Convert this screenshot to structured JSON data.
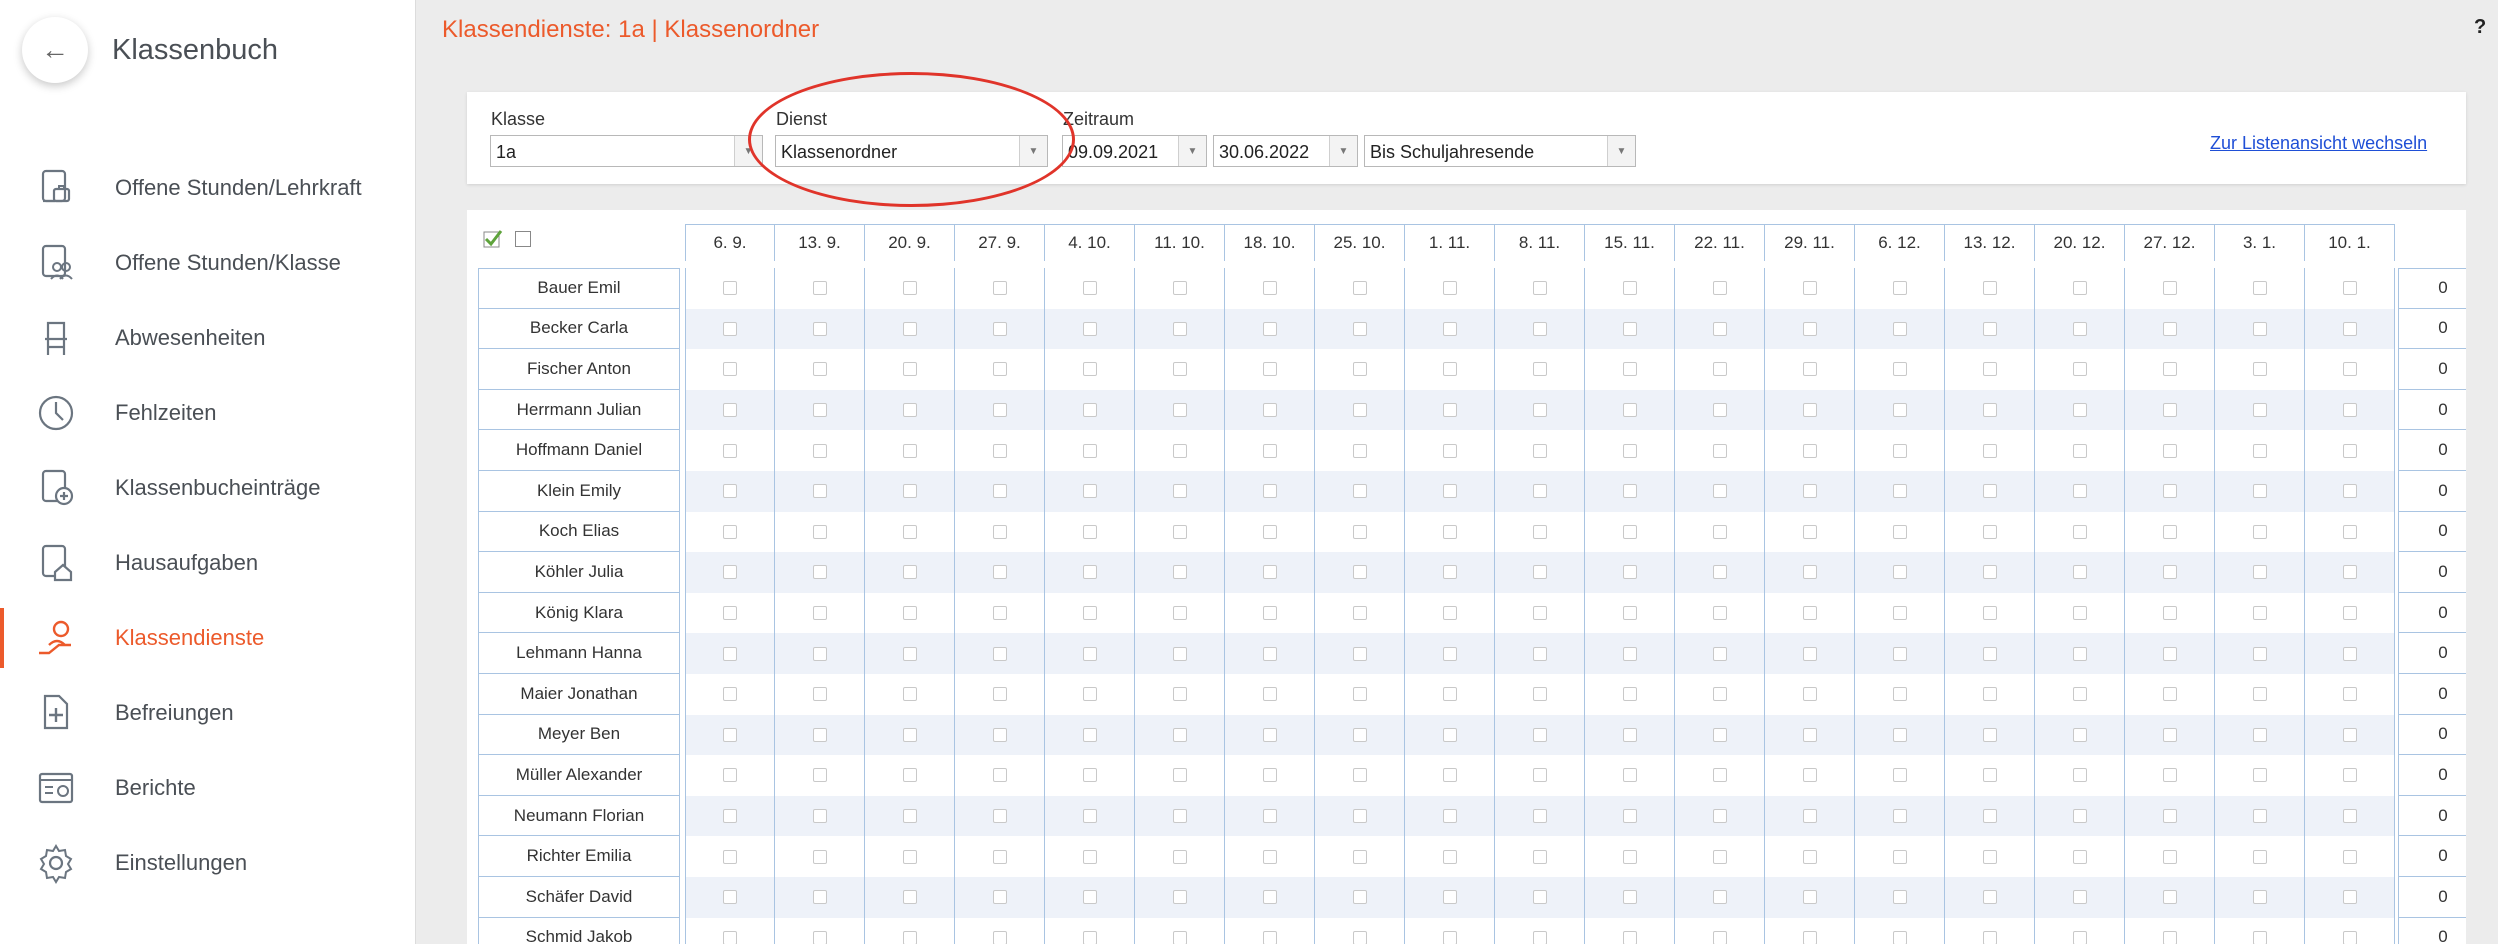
{
  "sidebar": {
    "back_icon": "arrow-left-icon",
    "title": "Klassenbuch",
    "items": [
      {
        "label": "Offene Stunden/Lehrkraft",
        "icon": "lesson-teacher-icon"
      },
      {
        "label": "Offene Stunden/Klasse",
        "icon": "lesson-class-icon"
      },
      {
        "label": "Abwesenheiten",
        "icon": "chair-icon"
      },
      {
        "label": "Fehlzeiten",
        "icon": "clock-icon"
      },
      {
        "label": "Klassenbucheinträge",
        "icon": "document-plus-icon"
      },
      {
        "label": "Hausaufgaben",
        "icon": "homework-icon"
      },
      {
        "label": "Klassendienste",
        "icon": "person-service-icon",
        "active": true
      },
      {
        "label": "Befreiungen",
        "icon": "document-cross-icon"
      },
      {
        "label": "Berichte",
        "icon": "report-icon"
      },
      {
        "label": "Einstellungen",
        "icon": "gear-icon"
      }
    ]
  },
  "header": {
    "title": "Klassendienste: 1a | Klassenordner",
    "help": "?"
  },
  "filters": {
    "klasse_label": "Klasse",
    "klasse_value": "1a",
    "dienst_label": "Dienst",
    "dienst_value": "Klassenordner",
    "zeitraum_label": "Zeitraum",
    "start_date": "09.09.2021",
    "end_date": "30.06.2022",
    "range_value": "Bis Schuljahresende",
    "list_view_link": "Zur Listenansicht wechseln"
  },
  "grid": {
    "dates": [
      "6. 9.",
      "13. 9.",
      "20. 9.",
      "27. 9.",
      "4. 10.",
      "11. 10.",
      "18. 10.",
      "25. 10.",
      "1. 11.",
      "8. 11.",
      "15. 11.",
      "22. 11.",
      "29. 11.",
      "6. 12.",
      "13. 12.",
      "20. 12.",
      "27. 12.",
      "3. 1.",
      "10. 1."
    ],
    "students": [
      {
        "name": "Bauer Emil",
        "total": "0"
      },
      {
        "name": "Becker Carla",
        "total": "0"
      },
      {
        "name": "Fischer Anton",
        "total": "0"
      },
      {
        "name": "Herrmann Julian",
        "total": "0"
      },
      {
        "name": "Hoffmann Daniel",
        "total": "0"
      },
      {
        "name": "Klein Emily",
        "total": "0"
      },
      {
        "name": "Koch Elias",
        "total": "0"
      },
      {
        "name": "Köhler Julia",
        "total": "0"
      },
      {
        "name": "König Klara",
        "total": "0"
      },
      {
        "name": "Lehmann Hanna",
        "total": "0"
      },
      {
        "name": "Maier Jonathan",
        "total": "0"
      },
      {
        "name": "Meyer Ben",
        "total": "0"
      },
      {
        "name": "Müller Alexander",
        "total": "0"
      },
      {
        "name": "Neumann Florian",
        "total": "0"
      },
      {
        "name": "Richter Emilia",
        "total": "0"
      },
      {
        "name": "Schäfer David",
        "total": "0"
      },
      {
        "name": "Schmid Jakob",
        "total": "0"
      }
    ]
  },
  "colors": {
    "accent": "#ec5a2b",
    "highlight": "#e0342a",
    "link": "#1f4fd6",
    "grid_border": "#a9c4e2"
  }
}
